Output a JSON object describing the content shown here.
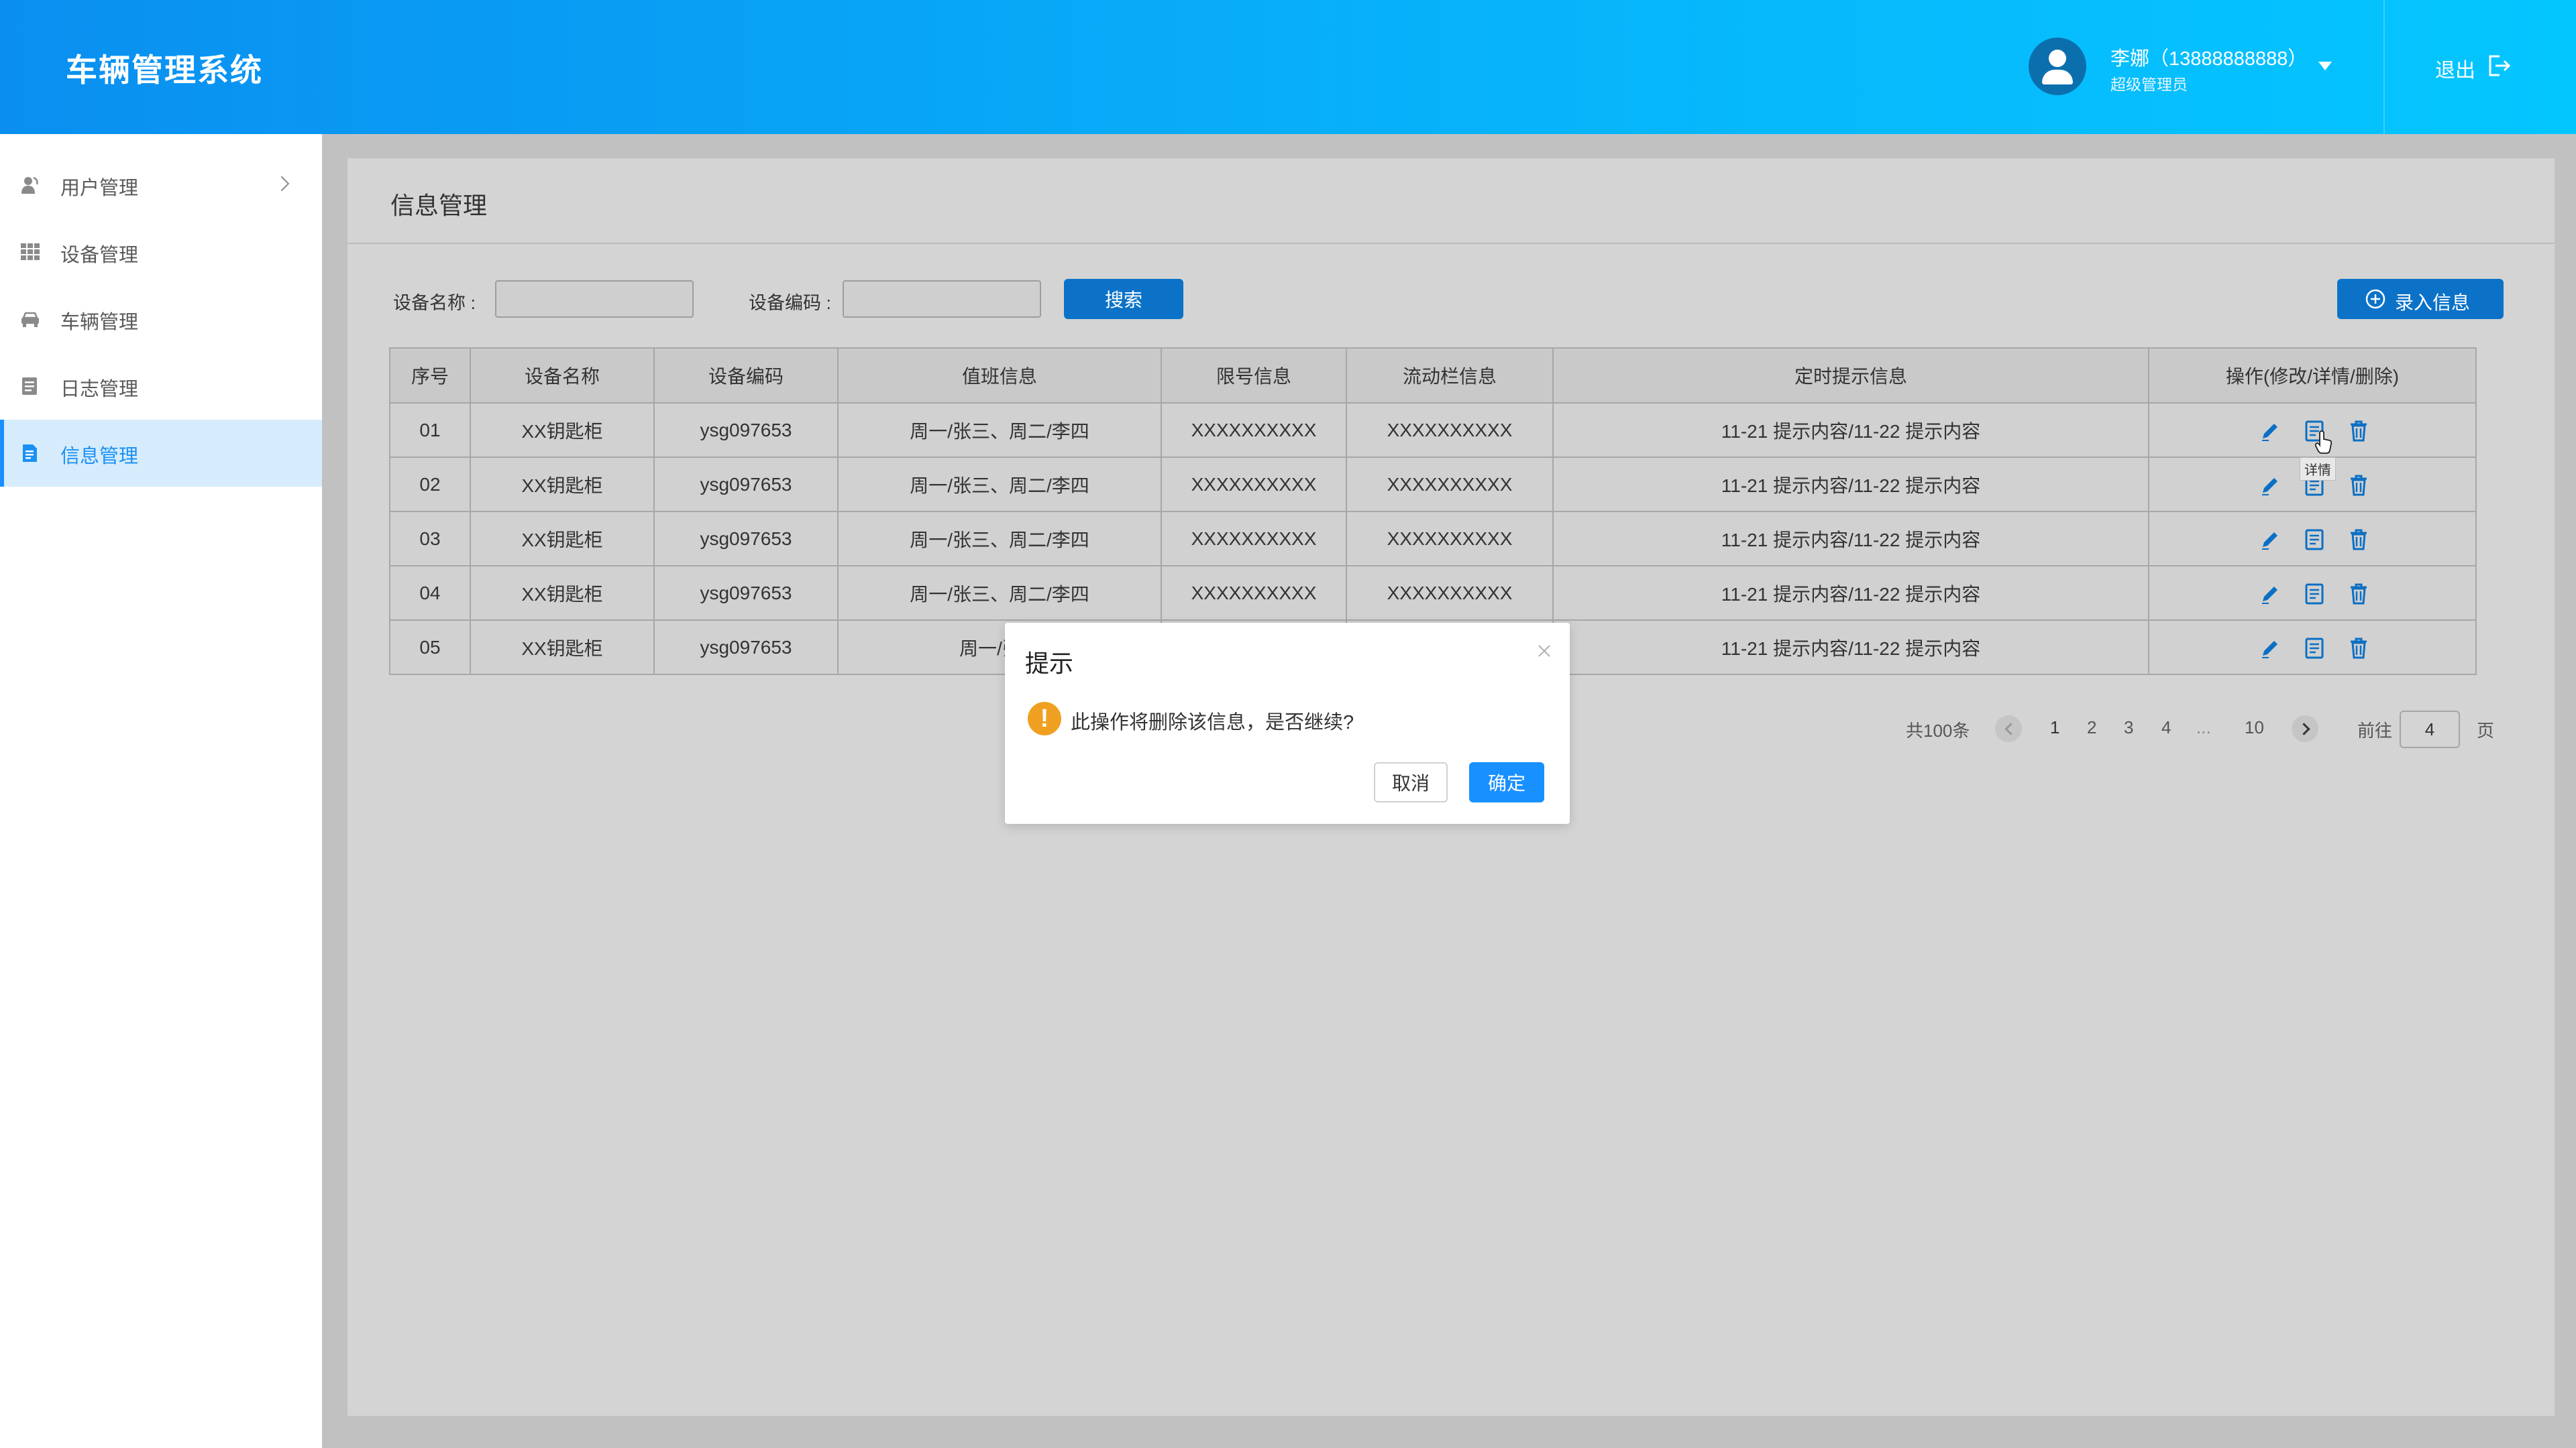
{
  "header": {
    "app_title": "车辆管理系统",
    "user_name": "李娜（13888888888）",
    "user_role": "超级管理员",
    "logout_label": "退出"
  },
  "sidebar": {
    "items": [
      {
        "label": "用户管理",
        "icon": "user-icon"
      },
      {
        "label": "设备管理",
        "icon": "grid-icon"
      },
      {
        "label": "车辆管理",
        "icon": "car-icon"
      },
      {
        "label": "日志管理",
        "icon": "log-icon"
      },
      {
        "label": "信息管理",
        "icon": "document-icon",
        "active": true
      }
    ]
  },
  "main": {
    "title": "信息管理",
    "filters": {
      "device_name_label": "设备名称 :",
      "device_name_value": "",
      "device_code_label": "设备编码 :",
      "device_code_value": "",
      "search_label": "搜索",
      "add_label": "录入信息"
    },
    "table": {
      "columns": [
        "序号",
        "设备名称",
        "设备编码",
        "值班信息",
        "限号信息",
        "流动栏信息",
        "定时提示信息",
        "操作(修改/详情/删除)"
      ],
      "rows": [
        [
          "01",
          "XX钥匙柜",
          "ysg097653",
          "周一/张三、周二/李四",
          "XXXXXXXXXX",
          "XXXXXXXXXX",
          "11-21 提示内容/11-22 提示内容"
        ],
        [
          "02",
          "XX钥匙柜",
          "ysg097653",
          "周一/张三、周二/李四",
          "XXXXXXXXXX",
          "XXXXXXXXXX",
          "11-21 提示内容/11-22 提示内容"
        ],
        [
          "03",
          "XX钥匙柜",
          "ysg097653",
          "周一/张三、周二/李四",
          "XXXXXXXXXX",
          "XXXXXXXXXX",
          "11-21 提示内容/11-22 提示内容"
        ],
        [
          "04",
          "XX钥匙柜",
          "ysg097653",
          "周一/张三、周二/李四",
          "XXXXXXXXXX",
          "XXXXXXXXXX",
          "11-21 提示内容/11-22 提示内容"
        ],
        [
          "05",
          "XX钥匙柜",
          "ysg097653",
          "周一/张三",
          "",
          "",
          "11-21 提示内容/11-22 提示内容"
        ]
      ],
      "tooltip": "详情"
    },
    "pagination": {
      "total": "共100条",
      "pages": [
        "1",
        "2",
        "3",
        "4",
        "...",
        "10"
      ],
      "goto_label": "前往",
      "goto_value": "4",
      "page_suffix": "页"
    }
  },
  "modal": {
    "title": "提示",
    "message": "此操作将删除该信息，是否继续?",
    "cancel_label": "取消",
    "confirm_label": "确定"
  },
  "colors": {
    "header_start": "#0a8ff0",
    "header_end": "#04c6ff",
    "primary": "#1890ff",
    "warning": "#f0a020"
  }
}
